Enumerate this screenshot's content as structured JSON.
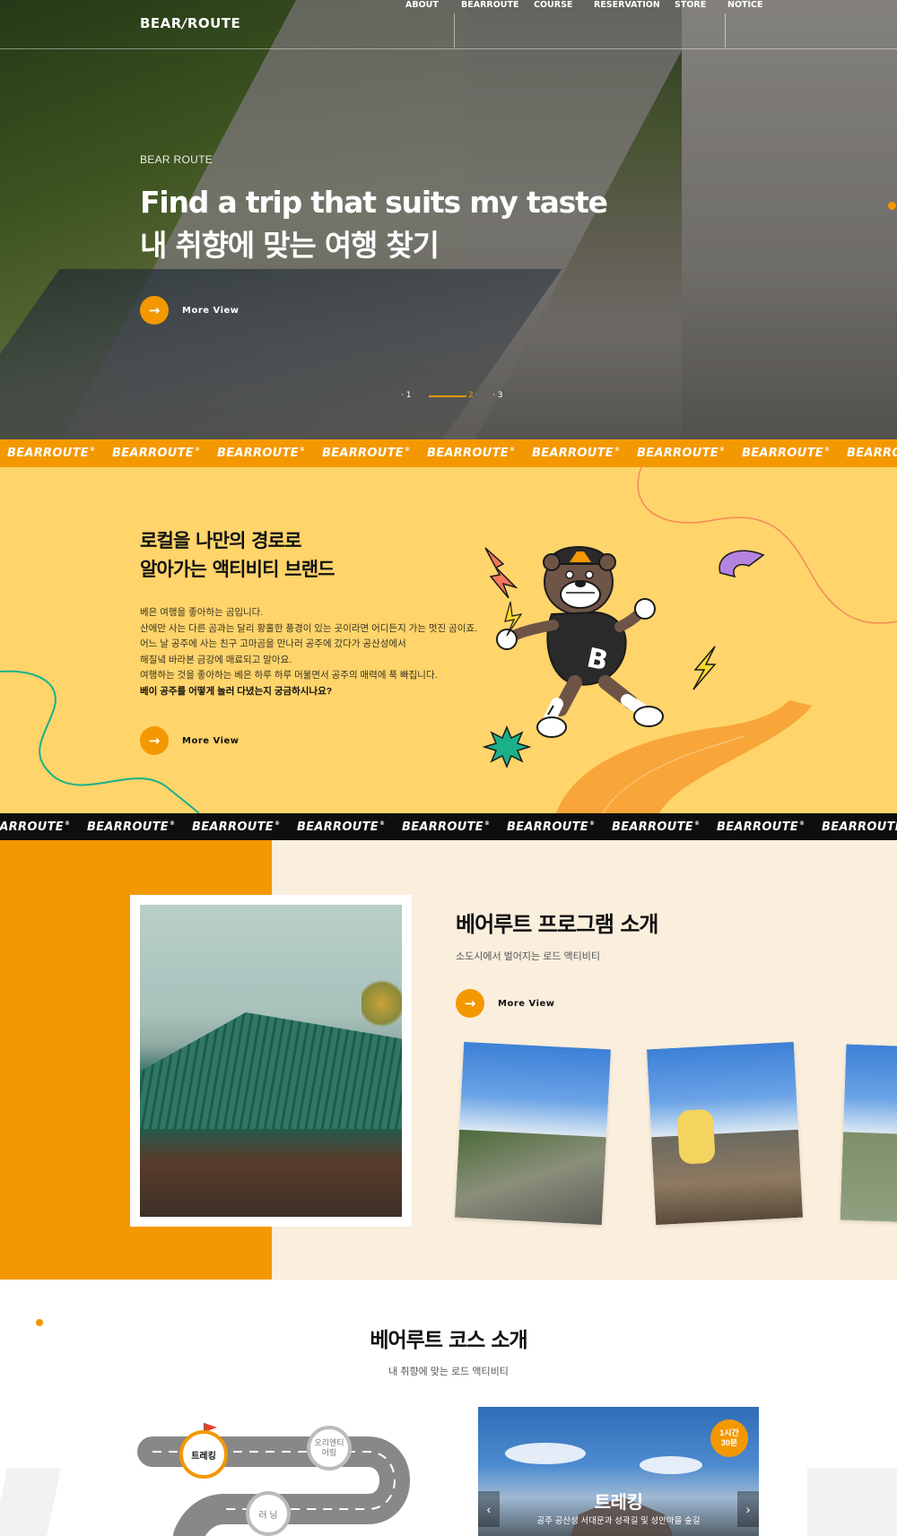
{
  "brand": {
    "logo_left": "BEAR",
    "logo_right": "ROUTE",
    "accent": "#f39800",
    "yellow": "#fed46b",
    "cream": "#faeedd"
  },
  "nav": {
    "items": [
      "ABOUT",
      "BEARROUTE",
      "COURSE",
      "RESERVATION",
      "STORE",
      "NOTICE"
    ]
  },
  "hero": {
    "eyebrow": "BEAR ROUTE",
    "title_line1": "Find a trip that suits my taste",
    "title_line2": "내 취향에 맞는 여행 찾기",
    "more_label": "More View",
    "pager": [
      "1",
      "2",
      "3"
    ],
    "active_page": 2
  },
  "marquee": {
    "text": "BEARROUTE",
    "mark": "®"
  },
  "intro": {
    "title_line1": "로컬을 나만의 경로로",
    "title_line2": "알아가는 액티비티 브랜드",
    "body": [
      "베은 여행을 좋아하는 곰입니다.",
      "산에만 사는 다른 곰과는 달리 황홀한 풍경이 있는 곳이라면 어디든지 가는 멋진 곰이죠.",
      "어느 날 공주에 사는 친구 고마곰을 만나러 공주에 갔다가 공산성에서",
      "해질녘 바라본 금강에 매료되고 말아요.",
      "여행하는 것을 좋아하는 베은 하루 하루 머물면서 공주의 매력에 푹 빠집니다."
    ],
    "body_strong": "베이 공주를 어떻게 놀러 다녔는지 궁금하시나요?",
    "more_label": "More View",
    "mascot_letter": "B"
  },
  "program": {
    "title": "베어루트 프로그램 소개",
    "subtitle": "소도시에서 벌어지는 로드 액티비티",
    "more_label": "More View"
  },
  "course": {
    "title": "베어루트 코스 소개",
    "subtitle": "내 취향에 맞는 로드 액티비티",
    "nodes": [
      "트레킹",
      "오리엔티어링",
      "러 닝"
    ],
    "node_orienteering_line1": "오리엔티",
    "node_orienteering_line2": "어링",
    "slide": {
      "time_line1": "1시간",
      "time_line2": "30분",
      "title": "트레킹",
      "desc": "공주 공산성 서대문과 성곽길 및 성안마을 숲길",
      "prev": "‹",
      "next": "›"
    }
  }
}
